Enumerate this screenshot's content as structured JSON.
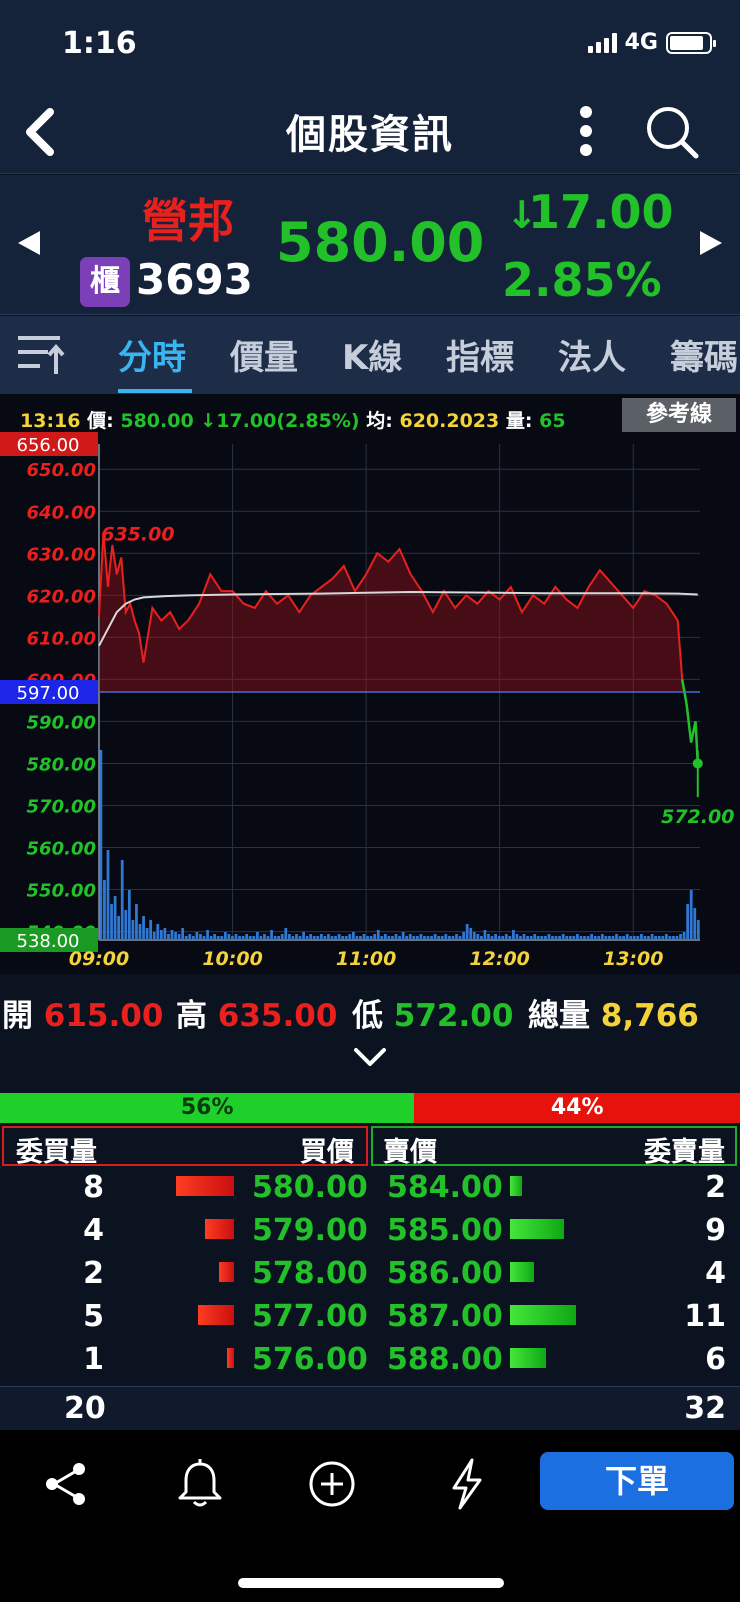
{
  "status_bar": {
    "time": "1:16",
    "network": "4G"
  },
  "header": {
    "title": "個股資訊"
  },
  "quote": {
    "name": "營邦",
    "market_badge": "櫃",
    "code": "3693",
    "price": "580.00",
    "change_arrow": "↓",
    "change": "17.00",
    "change_pct": "2.85%"
  },
  "tabs": [
    {
      "label": "分時",
      "active": true
    },
    {
      "label": "價量"
    },
    {
      "label": "K線"
    },
    {
      "label": "指標"
    },
    {
      "label": "法人"
    },
    {
      "label": "籌碼"
    }
  ],
  "chart_info": {
    "time": "13:16",
    "price_label": "價:",
    "price": "580.00",
    "change": "↓17.00(2.85%)",
    "avg_label": "均:",
    "avg": "620.2023",
    "vol_label": "量:",
    "vol": "65",
    "ref_button": "參考線"
  },
  "chart_data": {
    "type": "line",
    "title": "",
    "xlabel": "",
    "ylabel": "",
    "ylim": [
      538,
      656
    ],
    "reference_price": 597.0,
    "x_ticks": [
      "09:00",
      "10:00",
      "11:00",
      "12:00",
      "13:00"
    ],
    "y_ticks": [
      "650.00",
      "640.00",
      "630.00",
      "620.00",
      "610.00",
      "600.00",
      "590.00",
      "580.00",
      "570.00",
      "560.00",
      "550.00",
      "540.00"
    ],
    "high_label": "656.00",
    "ref_label": "597.00",
    "low_label": "538.00",
    "max_annotation": "635.00",
    "min_annotation": "572.00",
    "series": [
      {
        "name": "價",
        "color": "#e8201e",
        "x_minutes": [
          0,
          2,
          4,
          6,
          8,
          10,
          12,
          14,
          16,
          18,
          20,
          24,
          28,
          32,
          36,
          40,
          45,
          50,
          55,
          60,
          65,
          70,
          75,
          80,
          85,
          90,
          95,
          100,
          105,
          110,
          115,
          120,
          125,
          130,
          135,
          140,
          145,
          150,
          155,
          160,
          165,
          170,
          175,
          180,
          185,
          190,
          195,
          200,
          205,
          210,
          215,
          220,
          225,
          230,
          235,
          240,
          245,
          250,
          255,
          260,
          262,
          264,
          266,
          268,
          269
        ],
        "values": [
          615,
          635,
          622,
          632,
          625,
          629,
          616,
          618,
          614,
          611,
          604,
          617,
          614,
          616,
          612,
          614,
          618,
          625,
          621,
          621,
          618,
          617,
          621,
          618,
          620,
          616,
          620,
          622,
          624,
          627,
          621,
          625,
          630,
          628,
          631,
          625,
          621,
          616,
          621,
          617,
          620,
          618,
          621,
          619,
          622,
          616,
          620,
          618,
          622,
          619,
          617,
          622,
          626,
          623,
          620,
          617,
          621,
          620,
          618,
          614,
          600,
          594,
          585,
          590,
          580
        ]
      },
      {
        "name": "均",
        "color": "#d8d8d8",
        "x_minutes": [
          0,
          4,
          8,
          12,
          16,
          20,
          30,
          40,
          60,
          80,
          100,
          120,
          140,
          160,
          180,
          200,
          220,
          240,
          260,
          269
        ],
        "values": [
          608,
          612,
          616,
          618,
          619,
          619.5,
          619.8,
          620,
          620.2,
          620.3,
          620.4,
          620.6,
          620.8,
          620.7,
          620.6,
          620.5,
          620.5,
          620.5,
          620.4,
          620.2
        ]
      }
    ],
    "volume": {
      "color": "#2f79d4",
      "values": [
        95,
        30,
        45,
        18,
        22,
        12,
        40,
        15,
        25,
        10,
        18,
        8,
        12,
        6,
        10,
        4,
        8,
        5,
        6,
        3,
        5,
        4,
        3,
        6,
        2,
        3,
        2,
        4,
        3,
        2,
        5,
        2,
        3,
        2,
        2,
        4,
        3,
        2,
        3,
        2,
        2,
        3,
        2,
        2,
        4,
        2,
        3,
        2,
        5,
        2,
        2,
        3,
        6,
        3,
        2,
        3,
        2,
        4,
        2,
        3,
        2,
        2,
        3,
        2,
        3,
        2,
        2,
        3,
        2,
        2,
        3,
        4,
        2,
        2,
        3,
        2,
        2,
        3,
        5,
        2,
        3,
        2,
        2,
        3,
        2,
        4,
        2,
        3,
        2,
        2,
        3,
        2,
        2,
        2,
        3,
        2,
        2,
        3,
        2,
        2,
        3,
        2,
        4,
        8,
        6,
        4,
        3,
        2,
        5,
        3,
        2,
        3,
        2,
        2,
        3,
        2,
        5,
        3,
        2,
        3,
        2,
        2,
        3,
        2,
        2,
        2,
        3,
        2,
        2,
        2,
        3,
        2,
        2,
        2,
        3,
        2,
        2,
        2,
        3,
        2,
        2,
        3,
        2,
        2,
        2,
        3,
        2,
        2,
        3,
        2,
        2,
        2,
        3,
        2,
        2,
        3,
        2,
        2,
        2,
        3,
        2,
        2,
        2,
        3,
        4,
        18,
        25,
        16,
        10
      ]
    }
  },
  "ohlc": {
    "open_label": "開",
    "open": "615.00",
    "high_label": "高",
    "high": "635.00",
    "low_label": "低",
    "low": "572.00",
    "volume_label": "總量",
    "volume": "8,766"
  },
  "ratio": {
    "buy_pct": "56%",
    "sell_pct": "44%",
    "buy_fraction": 0.56
  },
  "order_book": {
    "headers": {
      "bid_qty": "委買量",
      "bid_price": "買價",
      "ask_price": "賣價",
      "ask_qty": "委賣量"
    },
    "rows": [
      {
        "bid_qty": "8",
        "bid_price": "580.00",
        "ask_price": "584.00",
        "ask_qty": "2"
      },
      {
        "bid_qty": "4",
        "bid_price": "579.00",
        "ask_price": "585.00",
        "ask_qty": "9"
      },
      {
        "bid_qty": "2",
        "bid_price": "578.00",
        "ask_price": "586.00",
        "ask_qty": "4"
      },
      {
        "bid_qty": "5",
        "bid_price": "577.00",
        "ask_price": "587.00",
        "ask_qty": "11"
      },
      {
        "bid_qty": "1",
        "bid_price": "576.00",
        "ask_price": "588.00",
        "ask_qty": "6"
      }
    ],
    "totals": {
      "bid": "20",
      "ask": "32"
    }
  },
  "bottom_bar": {
    "icons": [
      "share-icon",
      "bell-icon",
      "add-circle-icon",
      "lightning-icon"
    ],
    "order_button": "下單"
  },
  "colors": {
    "up": "#e8201e",
    "down": "#22c12a",
    "accent": "#39b5f0",
    "order_button": "#1c6fe0"
  }
}
